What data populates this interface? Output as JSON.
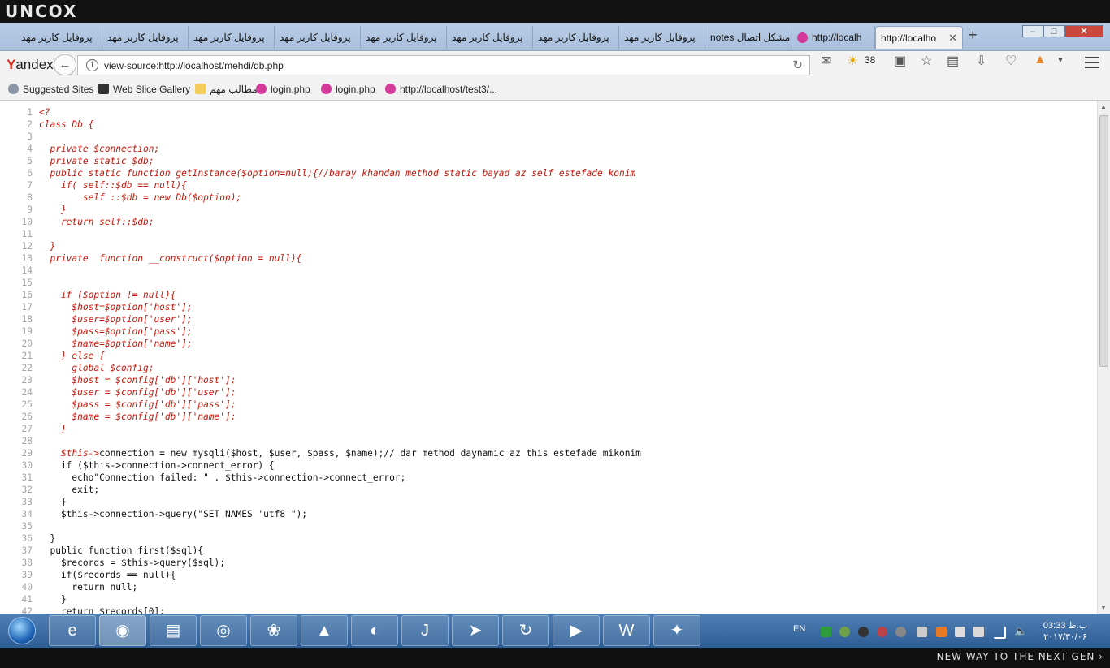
{
  "window": {
    "brand": "UNCOX",
    "tagline": "NEW WAY TO THE NEXT GEN ›"
  },
  "tabs": [
    {
      "label": "پروفایل کاربر مهد"
    },
    {
      "label": "پروفایل کاربر مهد"
    },
    {
      "label": "پروفایل کاربر مهد"
    },
    {
      "label": "پروفایل کاربر مهد"
    },
    {
      "label": "پروفایل کاربر مهد"
    },
    {
      "label": "پروفایل کاربر مهد"
    },
    {
      "label": "پروفایل کاربر مهد"
    },
    {
      "label": "پروفایل کاربر مهد"
    },
    {
      "label": "مشکل اتصال notes"
    },
    {
      "label": "http://localh"
    },
    {
      "label": "http://localho"
    }
  ],
  "navbar": {
    "logo_first": "Y",
    "logo_rest": "andex",
    "url": "view-source:http://localhost/mehdi/db.php",
    "weather": "38"
  },
  "bookmarks": [
    {
      "label": "Suggested Sites",
      "icon": "globe-icon"
    },
    {
      "label": "Web Slice Gallery",
      "icon": "web-slice-icon"
    },
    {
      "label": "مطالب مهم",
      "icon": "folder-icon"
    },
    {
      "label": "login.php",
      "icon": "wamp-icon"
    },
    {
      "label": "login.php",
      "icon": "wamp-icon"
    },
    {
      "label": "http://localhost/test3/...",
      "icon": "wamp-icon"
    }
  ],
  "source": {
    "lines": [
      {
        "n": "1",
        "t": "<?",
        "s": "php"
      },
      {
        "n": "2",
        "t": "class Db {",
        "s": "php"
      },
      {
        "n": "3",
        "t": "",
        "s": "php"
      },
      {
        "n": "4",
        "t": "  private $connection;",
        "s": "php"
      },
      {
        "n": "5",
        "t": "  private static $db;",
        "s": "php"
      },
      {
        "n": "6",
        "t": "  public static function getInstance($option=null){//baray khandan method static bayad az self estefade konim",
        "s": "php"
      },
      {
        "n": "7",
        "t": "    if( self::$db == null){",
        "s": "php"
      },
      {
        "n": "8",
        "t": "        self ::$db = new Db($option);",
        "s": "php"
      },
      {
        "n": "9",
        "t": "    }",
        "s": "php"
      },
      {
        "n": "10",
        "t": "    return self::$db;",
        "s": "php"
      },
      {
        "n": "11",
        "t": "",
        "s": "php"
      },
      {
        "n": "12",
        "t": "  }",
        "s": "php"
      },
      {
        "n": "13",
        "t": "  private  function __construct($option = null){",
        "s": "php"
      },
      {
        "n": "14",
        "t": "",
        "s": "php"
      },
      {
        "n": "15",
        "t": "",
        "s": "php"
      },
      {
        "n": "16",
        "t": "    if ($option != null){",
        "s": "php"
      },
      {
        "n": "17",
        "t": "      $host=$option['host'];",
        "s": "php"
      },
      {
        "n": "18",
        "t": "      $user=$option['user'];",
        "s": "php"
      },
      {
        "n": "19",
        "t": "      $pass=$option['pass'];",
        "s": "php"
      },
      {
        "n": "20",
        "t": "      $name=$option['name'];",
        "s": "php"
      },
      {
        "n": "21",
        "t": "    } else {",
        "s": "php"
      },
      {
        "n": "22",
        "t": "      global $config;",
        "s": "php"
      },
      {
        "n": "23",
        "t": "      $host = $config['db']['host'];",
        "s": "php"
      },
      {
        "n": "24",
        "t": "      $user = $config['db']['user'];",
        "s": "php"
      },
      {
        "n": "25",
        "t": "      $pass = $config['db']['pass'];",
        "s": "php"
      },
      {
        "n": "26",
        "t": "      $name = $config['db']['name'];",
        "s": "php"
      },
      {
        "n": "27",
        "t": "    }",
        "s": "php"
      },
      {
        "n": "28",
        "t": "",
        "s": "php"
      },
      {
        "n": "29",
        "t": "    $this->",
        "s": "php",
        "rest": "connection = new mysqli($host, $user, $pass, $name);// dar method daynamic az this estefade mikonim"
      },
      {
        "n": "30",
        "t": "    if ($this->connection->connect_error) {",
        "s": "plain"
      },
      {
        "n": "31",
        "t": "      echo\"Connection failed: \" . $this->connection->connect_error;",
        "s": "plain"
      },
      {
        "n": "32",
        "t": "      exit;",
        "s": "plain"
      },
      {
        "n": "33",
        "t": "    }",
        "s": "plain"
      },
      {
        "n": "34",
        "t": "    $this->connection->query(\"SET NAMES 'utf8'\");",
        "s": "plain"
      },
      {
        "n": "35",
        "t": "",
        "s": "plain"
      },
      {
        "n": "36",
        "t": "  }",
        "s": "plain"
      },
      {
        "n": "37",
        "t": "  public function first($sql){",
        "s": "plain"
      },
      {
        "n": "38",
        "t": "    $records = $this->query($sql);",
        "s": "plain"
      },
      {
        "n": "39",
        "t": "    if($records == null){",
        "s": "plain"
      },
      {
        "n": "40",
        "t": "      return null;",
        "s": "plain"
      },
      {
        "n": "41",
        "t": "    }",
        "s": "plain"
      },
      {
        "n": "42",
        "t": "    return $records[0];",
        "s": "plain"
      }
    ]
  },
  "taskbar": {
    "apps": [
      {
        "icon": "internet-explorer-icon",
        "glyph": "e"
      },
      {
        "icon": "firefox-icon",
        "glyph": "◉"
      },
      {
        "icon": "file-explorer-icon",
        "glyph": "▤"
      },
      {
        "icon": "disk-utility-icon",
        "glyph": "◎"
      },
      {
        "icon": "media-player-icon",
        "glyph": "❀"
      },
      {
        "icon": "android-studio-icon",
        "glyph": "▲"
      },
      {
        "icon": "gom-player-icon",
        "glyph": "◐"
      },
      {
        "icon": "intellij-icon",
        "glyph": "J"
      },
      {
        "icon": "telegram-icon",
        "glyph": "➤"
      },
      {
        "icon": "sync-icon",
        "glyph": "↻"
      },
      {
        "icon": "video-player-icon",
        "glyph": "▶"
      },
      {
        "icon": "wamp-server-icon",
        "glyph": "W"
      },
      {
        "icon": "game-icon",
        "glyph": "✦"
      }
    ],
    "language": "EN",
    "time": "03:33 ب.ظ",
    "date": "۲۰۱۷/۳۰/۰۶"
  }
}
